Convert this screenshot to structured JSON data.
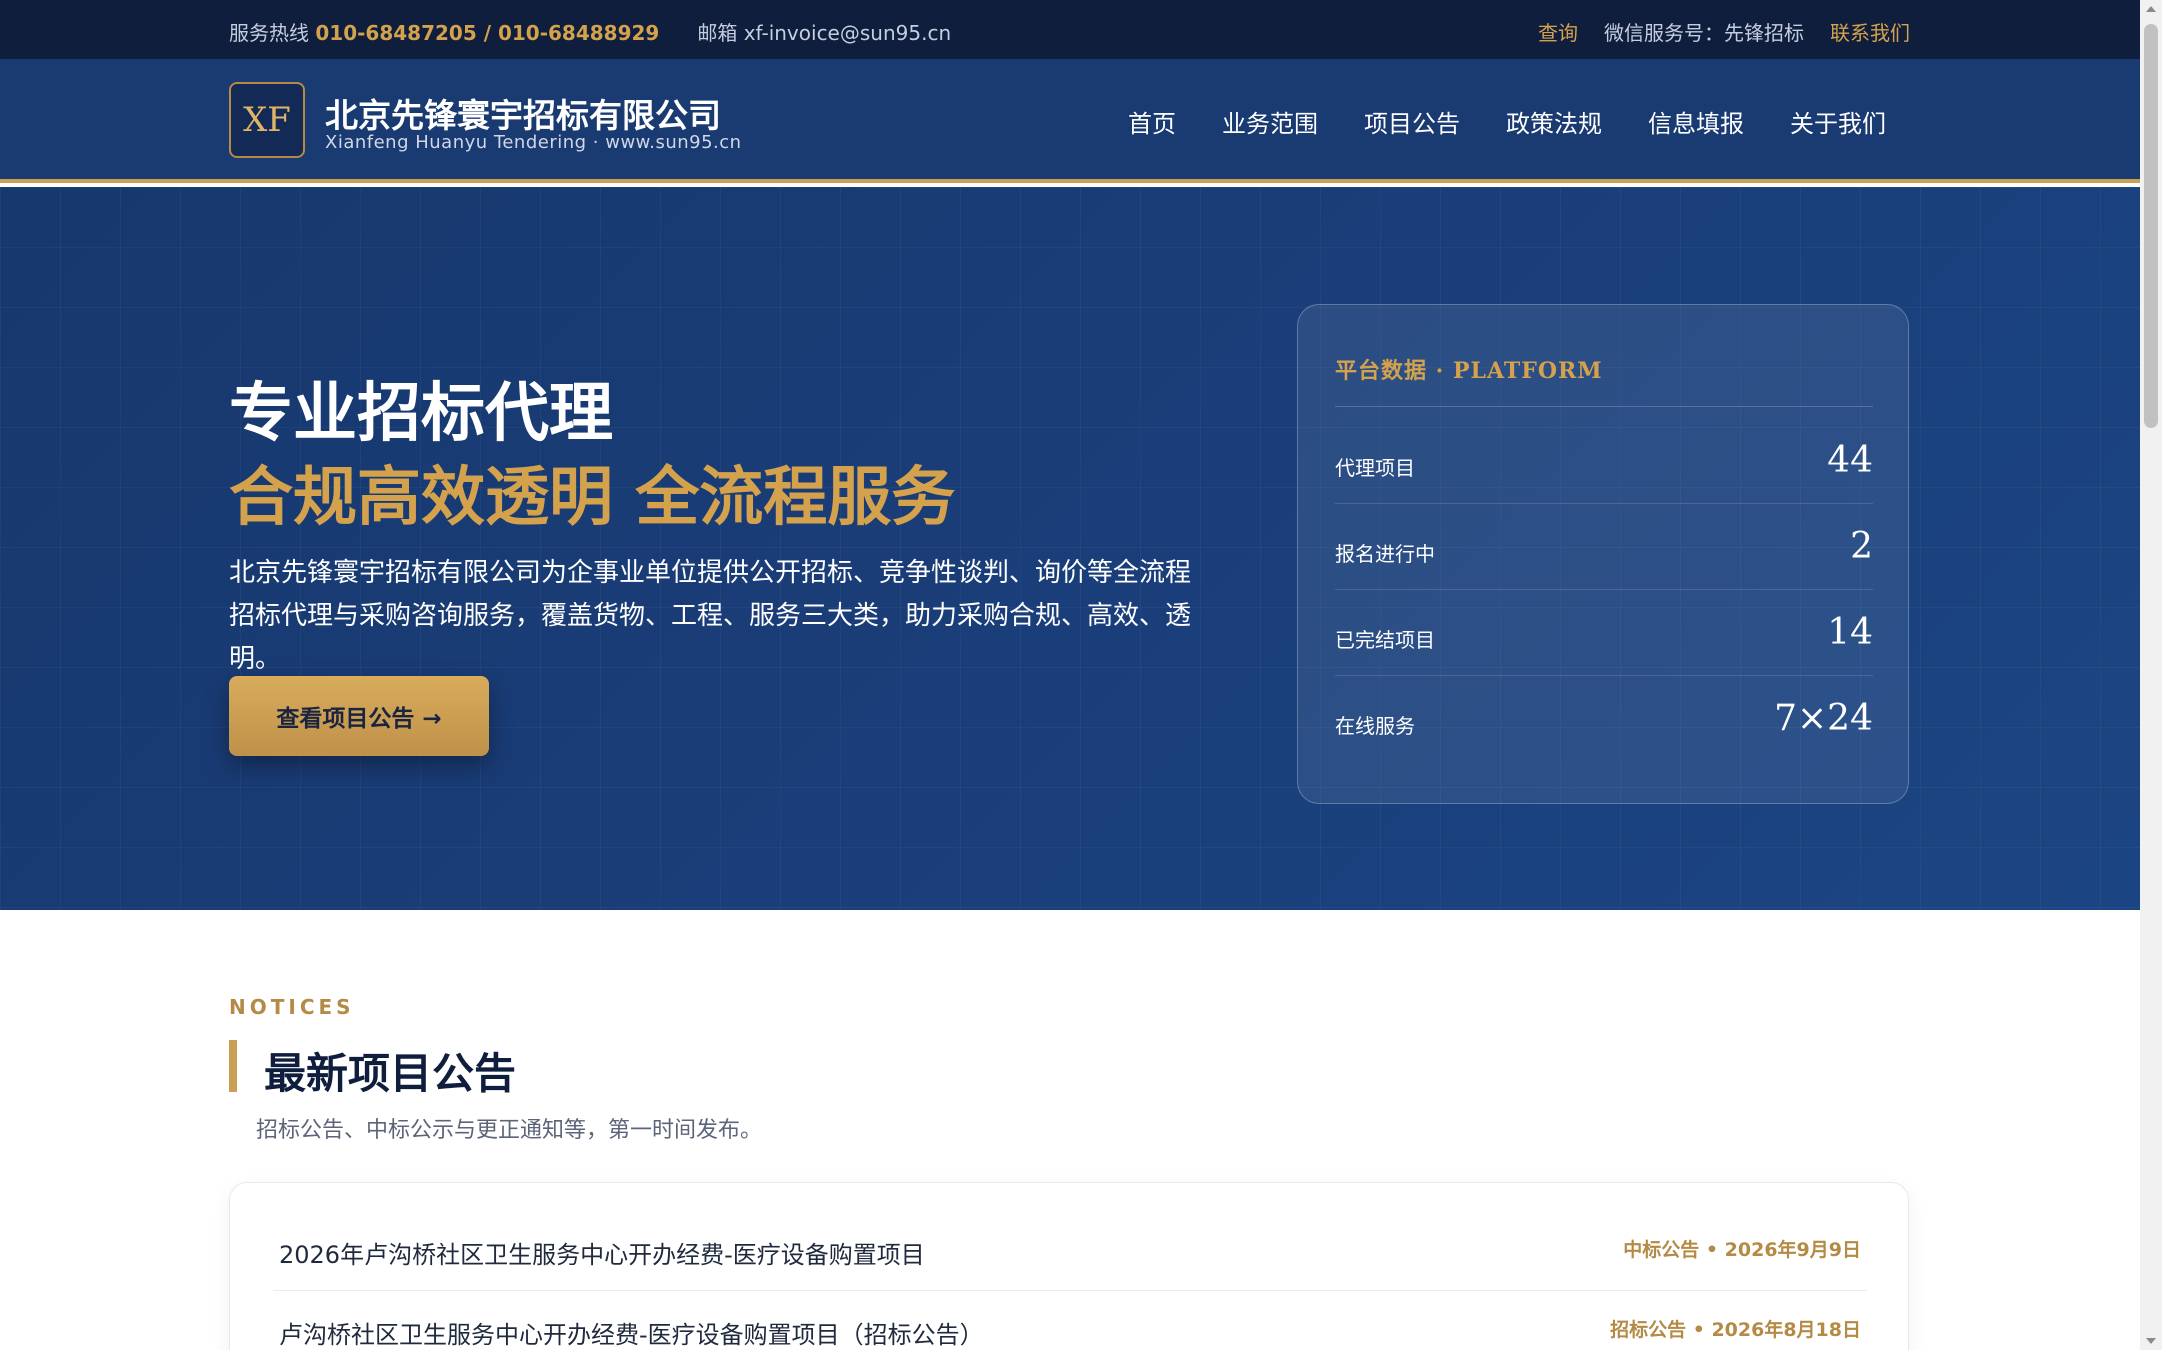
{
  "topbar": {
    "hotline_label": "服务热线",
    "hotline_numbers": "010-68487205 / 010-68488929",
    "email_label": "邮箱",
    "email": "xf-invoice@sun95.cn",
    "query": "查询",
    "wechat": "微信服务号：先锋招标",
    "contact": "联系我们"
  },
  "header": {
    "logo_text": "XF",
    "company_name": "北京先锋寰宇招标有限公司",
    "company_sub": "Xianfeng Huanyu Tendering · www.sun95.cn",
    "nav": [
      "首页",
      "业务范围",
      "项目公告",
      "政策法规",
      "信息填报",
      "关于我们"
    ]
  },
  "hero": {
    "title_line1": "专业招标代理",
    "title_line2": "合规高效透明 全流程服务",
    "description": "北京先锋寰宇招标有限公司为企事业单位提供公开招标、竞争性谈判、询价等全流程招标代理与采购咨询服务，覆盖货物、工程、服务三大类，助力采购合规、高效、透明。",
    "button": "查看项目公告 →"
  },
  "stats": {
    "title": "平台数据 · PLATFORM",
    "rows": [
      {
        "label": "代理项目",
        "value": "44"
      },
      {
        "label": "报名进行中",
        "value": "2"
      },
      {
        "label": "已完结项目",
        "value": "14"
      },
      {
        "label": "在线服务",
        "value": "7×24"
      }
    ]
  },
  "notices": {
    "tag": "NOTICES",
    "title": "最新项目公告",
    "subtitle": "招标公告、中标公示与更正通知等，第一时间发布。",
    "items": [
      {
        "title": "2026年卢沟桥社区卫生服务中心开办经费-医疗设备购置项目",
        "meta": "中标公告 • 2026年9月9日"
      },
      {
        "title": "卢沟桥社区卫生服务中心开办经费-医疗设备购置项目（招标公告）",
        "meta": "招标公告 • 2026年8月18日"
      }
    ]
  },
  "colors": {
    "navy": "#0f1e3d",
    "brand_blue": "#1a3a72",
    "gold": "#d4a24c"
  }
}
